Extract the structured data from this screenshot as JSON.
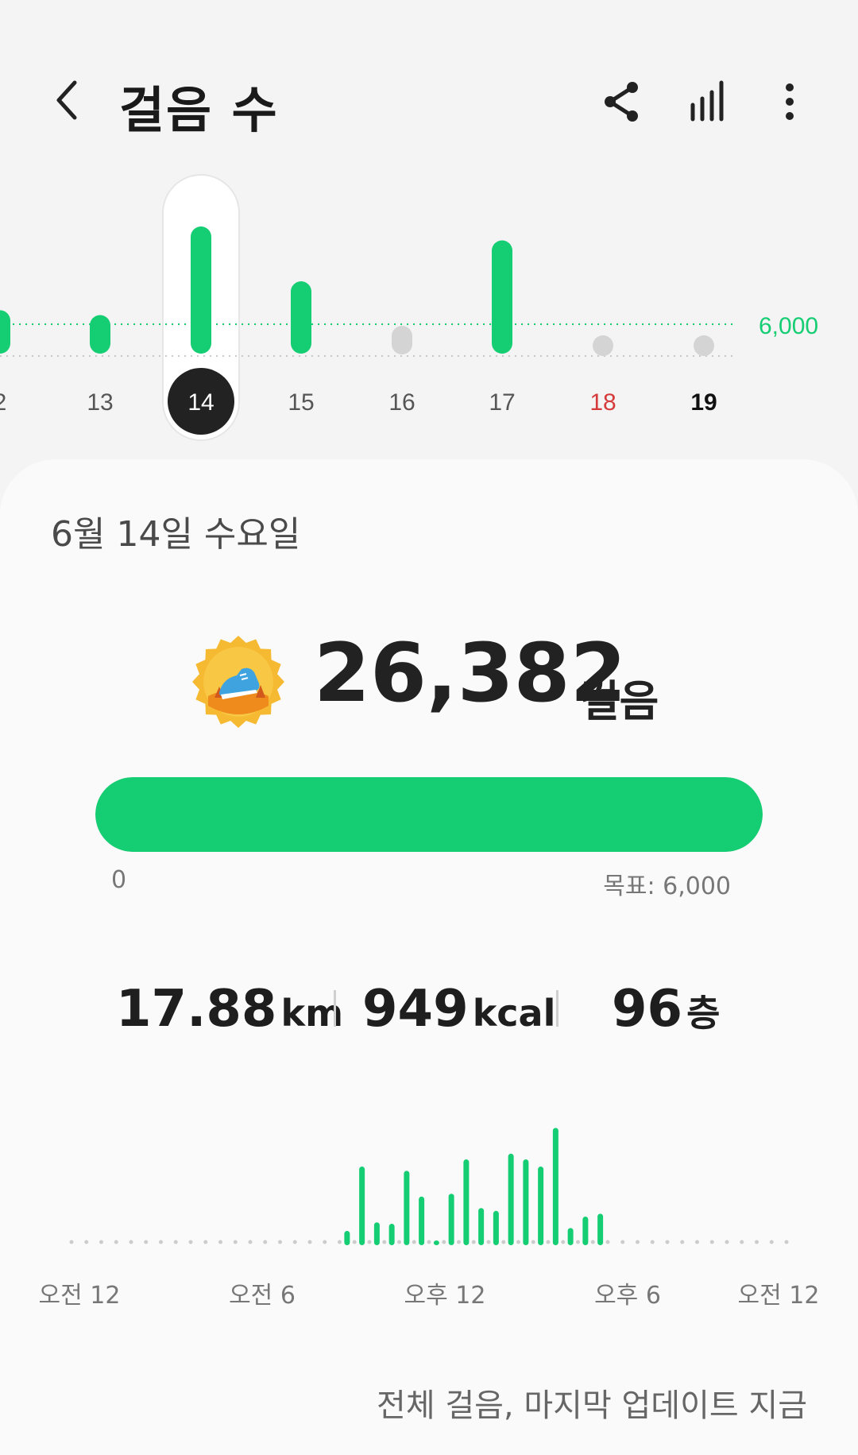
{
  "header": {
    "title": "걸음 수"
  },
  "week_chart": {
    "goal_label": "6,000",
    "days": [
      {
        "label": "2",
        "value": 9000,
        "state": "partial"
      },
      {
        "label": "13",
        "value": 8000,
        "state": "normal"
      },
      {
        "label": "14",
        "value": 26382,
        "state": "selected"
      },
      {
        "label": "15",
        "value": 15000,
        "state": "normal"
      },
      {
        "label": "16",
        "value": 2000,
        "state": "low"
      },
      {
        "label": "17",
        "value": 23500,
        "state": "normal"
      },
      {
        "label": "18",
        "value": 0,
        "state": "weekend"
      },
      {
        "label": "19",
        "value": 0,
        "state": "today"
      }
    ]
  },
  "detail": {
    "date": "6월 14일 수요일",
    "steps": "26,382",
    "steps_unit": "걸음",
    "progress_fraction": 1.0,
    "progress_min": "0",
    "progress_goal": "목표: 6,000",
    "distance_value": "17.88",
    "distance_unit": "km",
    "calories_value": "949",
    "calories_unit": "kcal",
    "floors_value": "96",
    "floors_unit": "층",
    "footer": "전체 걸음, 마지막 업데이트 지금"
  },
  "day_chart": {
    "x_labels": [
      "오전 12",
      "오전 6",
      "오후 12",
      "오후 6",
      "오전 12"
    ],
    "hourly_bars": [
      {
        "slot": 18,
        "value": 10
      },
      {
        "slot": 19,
        "value": 55
      },
      {
        "slot": 20,
        "value": 16
      },
      {
        "slot": 21,
        "value": 15
      },
      {
        "slot": 22,
        "value": 52
      },
      {
        "slot": 23,
        "value": 34
      },
      {
        "slot": 24,
        "value": 2
      },
      {
        "slot": 25,
        "value": 36
      },
      {
        "slot": 26,
        "value": 60
      },
      {
        "slot": 27,
        "value": 26
      },
      {
        "slot": 28,
        "value": 24
      },
      {
        "slot": 29,
        "value": 64
      },
      {
        "slot": 30,
        "value": 60
      },
      {
        "slot": 31,
        "value": 55
      },
      {
        "slot": 32,
        "value": 82
      },
      {
        "slot": 33,
        "value": 12
      },
      {
        "slot": 34,
        "value": 20
      },
      {
        "slot": 35,
        "value": 22
      }
    ]
  },
  "colors": {
    "accent": "#15cd72",
    "selected_day_bg": "#222222",
    "weekend": "#d63a3a",
    "inactive": "#d4d4d4"
  }
}
